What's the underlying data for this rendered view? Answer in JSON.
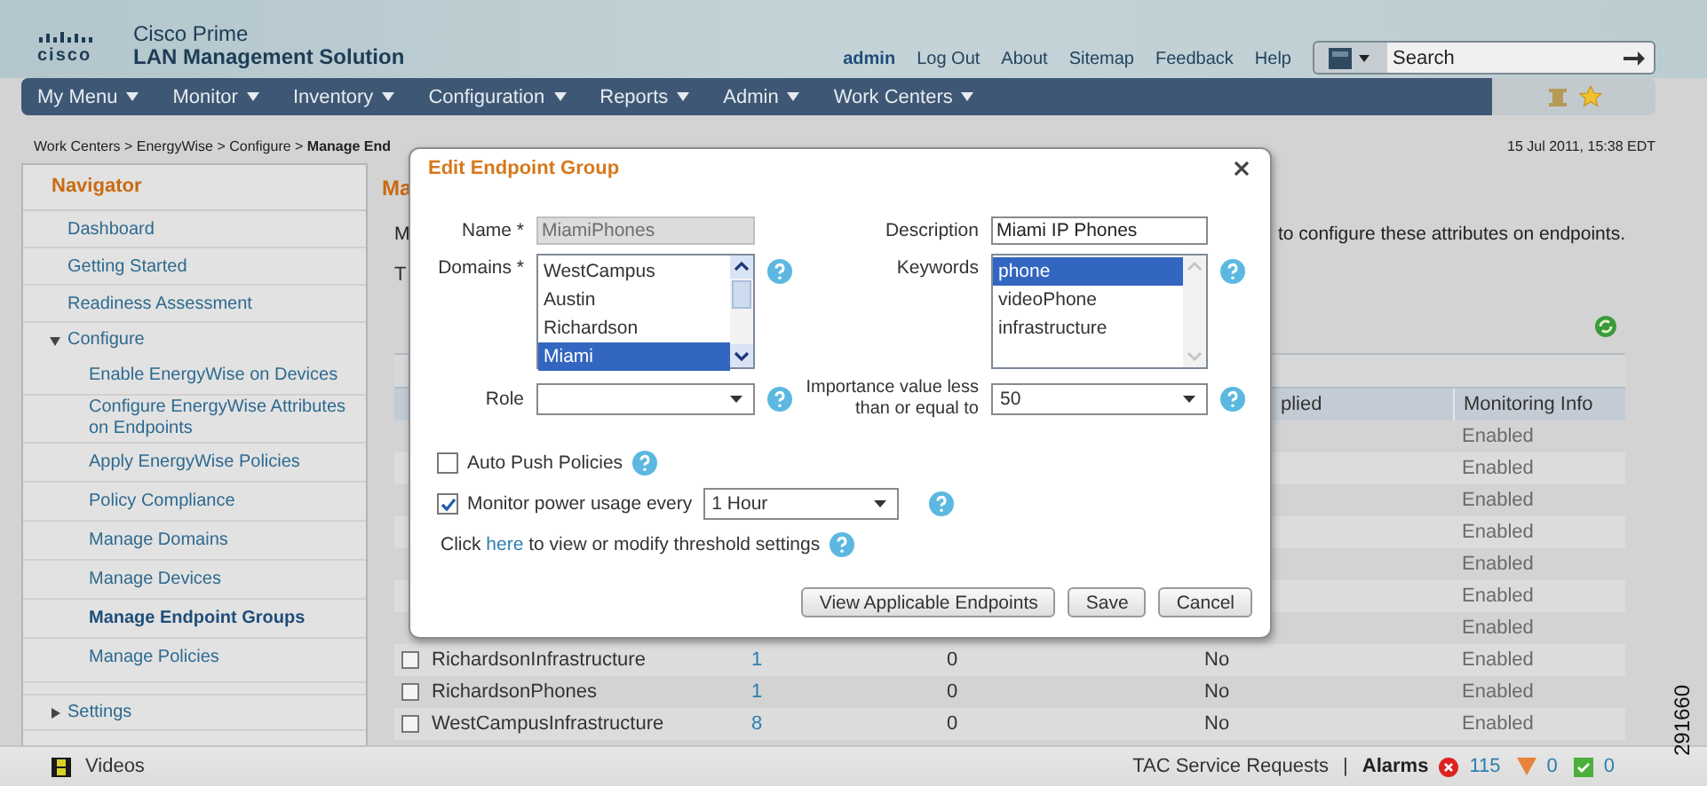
{
  "header": {
    "logo": "cisco",
    "product": "Cisco Prime",
    "product_sub": "LAN Management Solution",
    "user": "admin",
    "links": [
      "Log Out",
      "About",
      "Sitemap",
      "Feedback",
      "Help"
    ],
    "search": {
      "placeholder": "Search"
    }
  },
  "menu": [
    {
      "label": "My Menu"
    },
    {
      "label": "Monitor"
    },
    {
      "label": "Inventory"
    },
    {
      "label": "Configuration"
    },
    {
      "label": "Reports"
    },
    {
      "label": "Admin"
    },
    {
      "label": "Work Centers"
    }
  ],
  "breadcrumb": "Work Centers > EnergyWise > Configure > **Manage End**",
  "timestamp": "15 Jul 2011, 15:38 EDT",
  "navigator": {
    "title": "Navigator",
    "items": [
      {
        "label": "Dashboard",
        "selected": false
      },
      {
        "label": "Getting Started",
        "selected": false
      },
      {
        "label": "Readiness Assessment",
        "selected": false
      },
      {
        "label": "Configure",
        "expanded": true,
        "children": [
          {
            "label": "Enable EnergyWise on Devices",
            "selected": false
          },
          {
            "label": "Configure EnergyWise Attributes on Endpoints",
            "selected": false
          },
          {
            "label": "Apply EnergyWise Policies",
            "selected": false
          },
          {
            "label": "Policy Compliance",
            "selected": false
          },
          {
            "label": "Manage Domains",
            "selected": false
          },
          {
            "label": "Manage Devices",
            "selected": false
          },
          {
            "label": "Manage Endpoint Groups",
            "selected": true
          },
          {
            "label": "Manage Policies",
            "selected": false
          }
        ]
      },
      {
        "label": "Settings",
        "expanded": false
      }
    ]
  },
  "content": {
    "title_fragment": "Ma",
    "intro_fragment": "M",
    "intro_tail": "to configure these attributes on endpoints.",
    "note_fragment": "T",
    "table": {
      "columns": {
        "column_4": "plied",
        "monitoring_info": "Monitoring Info"
      },
      "rows": [
        {
          "monitoring_info": "Enabled"
        },
        {
          "monitoring_info": "Enabled"
        },
        {
          "monitoring_info": "Enabled"
        },
        {
          "monitoring_info": "Enabled"
        },
        {
          "monitoring_info": "Enabled"
        },
        {
          "monitoring_info": "Enabled"
        },
        {
          "monitoring_info": "Enabled"
        },
        {
          "checked": false,
          "name": "RichardsonInfrastructure",
          "column_2": "1",
          "column_3": "0",
          "column_4": "No",
          "monitoring_info": "Enabled"
        },
        {
          "checked": false,
          "name": "RichardsonPhones",
          "column_2": "1",
          "column_3": "0",
          "column_4": "No",
          "monitoring_info": "Enabled"
        },
        {
          "checked": false,
          "name": "WestCampusInfrastructure",
          "column_2": "8",
          "column_3": "0",
          "column_4": "No",
          "monitoring_info": "Enabled"
        }
      ]
    }
  },
  "dialog": {
    "title": "Edit Endpoint Group",
    "name": {
      "label": "Name *",
      "value": "MiamiPhones",
      "disabled": true
    },
    "description": {
      "label": "Description",
      "value": "Miami IP Phones"
    },
    "domains": {
      "label": "Domains *",
      "options": [
        {
          "label": "WestCampus",
          "selected": false
        },
        {
          "label": "Austin",
          "selected": false
        },
        {
          "label": "Richardson",
          "selected": false
        },
        {
          "label": "Miami",
          "selected": true
        }
      ]
    },
    "keywords": {
      "label": "Keywords",
      "options": [
        {
          "label": "phone",
          "selected": true
        },
        {
          "label": "videoPhone",
          "selected": false
        },
        {
          "label": "infrastructure",
          "selected": false
        }
      ]
    },
    "role": {
      "label": "Role"
    },
    "importance": {
      "label": "Importance value less than or equal to",
      "value": "50"
    },
    "auto_push": {
      "label": "Auto Push Policies",
      "checked": false
    },
    "monitor": {
      "label": "Monitor power usage every",
      "checked": true,
      "interval": "1 Hour"
    },
    "threshold": {
      "before": "Click ",
      "link": "here",
      "after": " to view or modify threshold settings"
    },
    "buttons": [
      "View Applicable Endpoints",
      "Save",
      "Cancel"
    ]
  },
  "status_bar": {
    "videos": "Videos",
    "tac": "TAC Service Requests",
    "separator": "|",
    "alarms_label": "Alarms",
    "alarms": [
      {
        "kind": "critical",
        "count": "115"
      },
      {
        "kind": "warning",
        "count": "0"
      },
      {
        "kind": "ok",
        "count": "0"
      }
    ]
  },
  "figure_number": "291660"
}
